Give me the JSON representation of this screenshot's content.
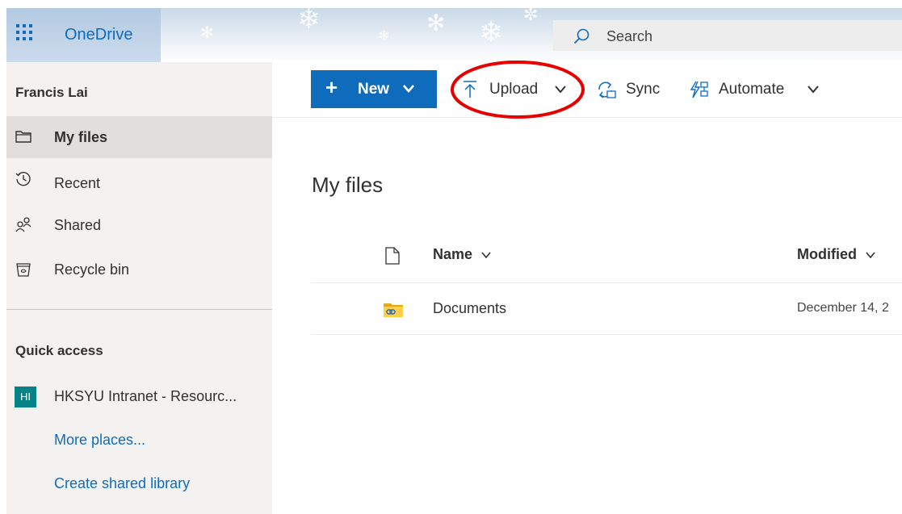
{
  "app": {
    "name": "OneDrive",
    "accent_color": "#0f6cbd"
  },
  "search": {
    "placeholder": "Search",
    "icon": "search-icon"
  },
  "sidebar": {
    "user_name": "Francis Lai",
    "nav_items": [
      {
        "label": "My files",
        "icon": "folder-icon",
        "selected": true
      },
      {
        "label": "Recent",
        "icon": "clock-icon",
        "selected": false
      },
      {
        "label": "Shared",
        "icon": "people-icon",
        "selected": false
      },
      {
        "label": "Recycle bin",
        "icon": "recycle-bin-icon",
        "selected": false
      }
    ],
    "quick_access_title": "Quick access",
    "quick_access_items": [
      {
        "badge": "HI",
        "label": "HKSYU Intranet - Resourc...",
        "badge_color": "#038387"
      }
    ],
    "more_places_label": "More places...",
    "create_library_label": "Create shared library"
  },
  "commands": {
    "new_label": "New",
    "upload_label": "Upload",
    "sync_label": "Sync",
    "automate_label": "Automate"
  },
  "annotation": {
    "type": "red-ellipse",
    "color": "#e60000",
    "target": "Upload"
  },
  "main": {
    "title": "My files",
    "columns": {
      "name": "Name",
      "modified": "Modified"
    },
    "rows": [
      {
        "name": "Documents",
        "modified": "December 14, 2",
        "icon": "shared-folder-icon"
      }
    ]
  }
}
